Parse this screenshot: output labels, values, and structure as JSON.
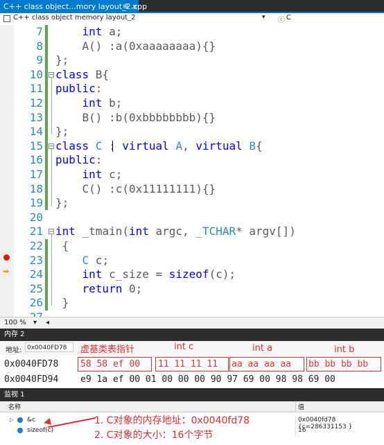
{
  "tab": {
    "title": "C++ class object...mory layout_2.cpp",
    "pin": "⊕",
    "close": "×"
  },
  "navbar": {
    "scope": "C++ class object memory layout_2",
    "member_icon": "ⓒ",
    "member": "C",
    "dropdown": "▾"
  },
  "editor": {
    "lines": [
      {
        "num": "7"
      },
      {
        "num": "8"
      },
      {
        "num": "9"
      },
      {
        "num": "10"
      },
      {
        "num": "11"
      },
      {
        "num": "12"
      },
      {
        "num": "13"
      },
      {
        "num": "14"
      },
      {
        "num": "15"
      },
      {
        "num": "16"
      },
      {
        "num": "17"
      },
      {
        "num": "18"
      },
      {
        "num": "19"
      },
      {
        "num": "20"
      },
      {
        "num": "21"
      },
      {
        "num": "22"
      },
      {
        "num": "23"
      },
      {
        "num": "24"
      },
      {
        "num": "25"
      },
      {
        "num": "26"
      },
      {
        "num": "27"
      }
    ],
    "code": {
      "l7": [
        "    ",
        "int",
        " a;"
      ],
      "l8": [
        "    A() :a(0xaaaaaaaa){}"
      ],
      "l9": [
        "};"
      ],
      "l10": [
        "class",
        " B{"
      ],
      "l11": [
        "public",
        ":"
      ],
      "l12": [
        "    ",
        "int",
        " b;"
      ],
      "l13": [
        "    B() :b(0xbbbbbbbb){}"
      ],
      "l14": [
        "};"
      ],
      "l15": [
        "class",
        " ",
        "C",
        " : ",
        "virtual",
        " ",
        "A",
        ", ",
        "virtual",
        " ",
        "B",
        "{"
      ],
      "l16": [
        "public",
        ":"
      ],
      "l17": [
        "    ",
        "int",
        " c;"
      ],
      "l18": [
        "    C() :c(0x11111111){}"
      ],
      "l19": [
        "};"
      ],
      "l20": [
        ""
      ],
      "l21": [
        "int",
        " ",
        "_tmain",
        "(",
        "int",
        " argc, ",
        "_TCHAR",
        "* argv[])"
      ],
      "l22": [
        " {"
      ],
      "l23": [
        "    ",
        "C",
        " c;"
      ],
      "l24": [
        "    ",
        "int",
        " c_size = ",
        "sizeof",
        "(c);"
      ],
      "l25": [
        "    ",
        "return",
        " 0;"
      ],
      "l26": [
        " }"
      ],
      "l27": [
        ""
      ]
    }
  },
  "zoom": {
    "level": "100 %",
    "dropdown": "▾",
    "scroll_left": "◂"
  },
  "memory": {
    "title": "内存 2",
    "address_label": "地址:",
    "address_value": "0x0040FD78",
    "row1_addr": "0x0040FD78",
    "row1_bytes": "58 58 ef 00 11 11 11 11 aa aa aa aa bb bb bb bb",
    "row2_addr": "0x0040FD94",
    "row2_bytes": "e9 1a ef 00 01 00 00 00 90 97 69 00 98 98 69 00",
    "row1_groups": [
      "58 58 ef 00",
      "11 11 11 11",
      "aa aa aa aa",
      "bb bb bb bb"
    ],
    "annotations": [
      "虚基类表指针",
      "int c",
      "int a",
      "int b"
    ]
  },
  "watch": {
    "title": "监视 1",
    "col_name": "名称",
    "col_value": "值",
    "rows": [
      {
        "expander": "▷",
        "name": "&c",
        "value": "0x0040fd78 {c=286331153 }"
      },
      {
        "expander": "",
        "name": "sizeof(c)",
        "value": "16"
      }
    ],
    "notes": [
      "1. C对象的内存地址：0x0040fd78",
      "2. C对象的大小：16个字节"
    ]
  }
}
